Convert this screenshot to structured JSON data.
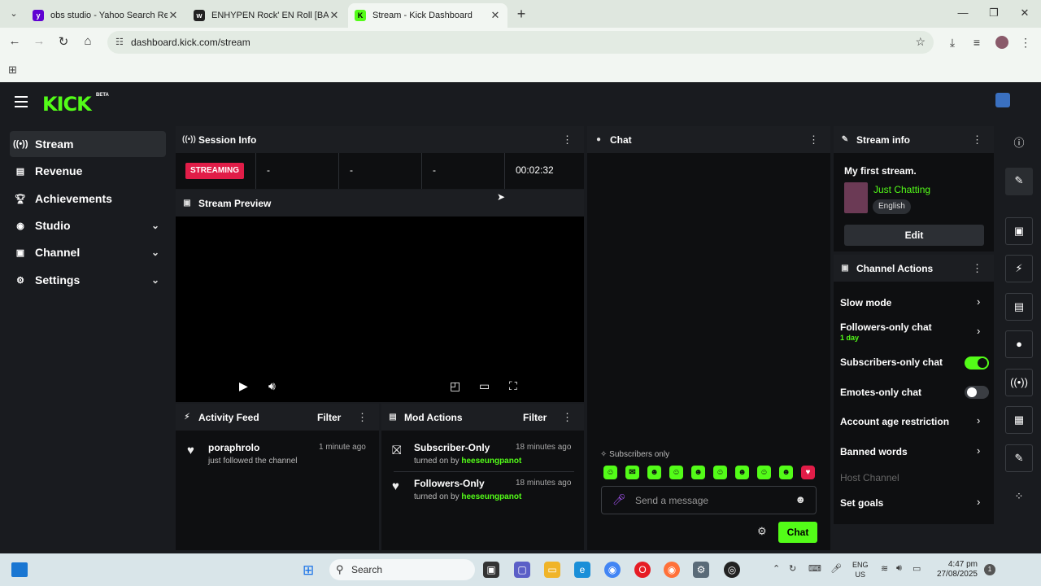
{
  "browser": {
    "tabs": [
      {
        "title": "obs studio - Yahoo Search Resu",
        "favicon": "yahoo-icon",
        "color": "#6001d2"
      },
      {
        "title": "ENHYPEN Rock' EN Roll [BAND",
        "favicon": "weverse-icon",
        "color": "#222222"
      },
      {
        "title": "Stream - Kick Dashboard",
        "favicon": "kick-icon",
        "color": "#53fc18"
      }
    ],
    "url": "dashboard.kick.com/stream"
  },
  "app": {
    "logo": "KICK",
    "beta": "BETA",
    "accent": "#53fc18",
    "danger": "#e11d48"
  },
  "sidebar": {
    "items": [
      {
        "label": "Stream",
        "icon": "broadcast-icon"
      },
      {
        "label": "Revenue",
        "icon": "revenue-icon"
      },
      {
        "label": "Achievements",
        "icon": "trophy-icon"
      },
      {
        "label": "Studio",
        "icon": "camera-icon"
      },
      {
        "label": "Channel",
        "icon": "channel-icon"
      },
      {
        "label": "Settings",
        "icon": "gear-icon"
      }
    ]
  },
  "session": {
    "title": "Session Info",
    "status": "STREAMING",
    "cells": [
      "-",
      "-",
      "-"
    ],
    "duration": "00:02:32"
  },
  "preview": {
    "title": "Stream Preview"
  },
  "activity": {
    "title": "Activity Feed",
    "filter": "Filter",
    "items": [
      {
        "name": "poraphrolo",
        "detail": "just followed the channel",
        "time": "1 minute ago"
      }
    ]
  },
  "mod": {
    "title": "Mod Actions",
    "filter": "Filter",
    "turned_on_by": "turned on by",
    "items": [
      {
        "name": "Subscriber-Only",
        "user": "heeseungpanot",
        "time": "18 minutes ago"
      },
      {
        "name": "Followers-Only",
        "user": "heeseungpanot",
        "time": "18 minutes ago"
      }
    ]
  },
  "chat": {
    "title": "Chat",
    "mode_notice": "Subscribers only",
    "placeholder": "Send a message",
    "send_label": "Chat"
  },
  "stream_info": {
    "title": "Stream info",
    "stream_title": "My first stream.",
    "category": "Just Chatting",
    "language": "English",
    "edit_label": "Edit"
  },
  "channel_actions": {
    "title": "Channel Actions",
    "slow_mode": "Slow mode",
    "followers_only": "Followers-only chat",
    "followers_duration": "1 day",
    "subscribers_only": "Subscribers-only chat",
    "subscribers_only_on": true,
    "emotes_only": "Emotes-only chat",
    "emotes_only_on": false,
    "account_age": "Account age restriction",
    "banned_words": "Banned words",
    "host_channel": "Host Channel",
    "set_goals": "Set goals"
  },
  "taskbar": {
    "search": "Search",
    "lang_1": "ENG",
    "lang_2": "US",
    "time": "4:47 pm",
    "date": "27/08/2025",
    "notifications": "1"
  }
}
